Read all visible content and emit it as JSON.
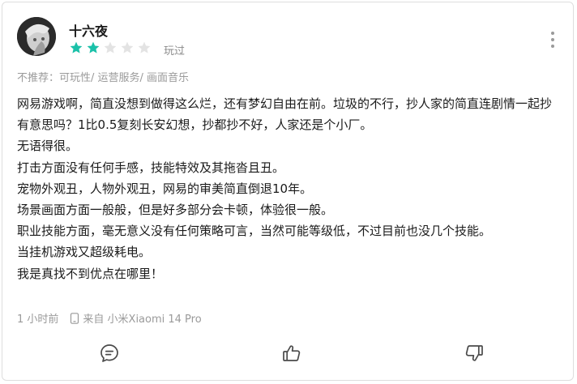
{
  "review": {
    "username": "十六夜",
    "rating": 2,
    "rating_max": 5,
    "played_label": "玩过",
    "tags": "不推荐：可玩性/ 运营服务/ 画面音乐",
    "body_lines": [
      "网易游戏啊，简直没想到做得这么烂，还有梦幻自由在前。垃圾的不行，抄人家的简直连剧情一起抄有意思吗？1比0.5复刻长安幻想，抄都抄不好，人家还是个小厂。",
      "无语得很。",
      "打击方面没有任何手感，技能特效及其拖沓且丑。",
      "宠物外观丑，人物外观丑，网易的审美简直倒退10年。",
      "场景画面方面一般般，但是好多部分会卡顿，体验很一般。",
      "职业技能方面，毫无意义没有任何策略可言，当然可能等级低，不过目前也没几个技能。",
      "当挂机游戏又超级耗电。",
      "我是真找不到优点在哪里！"
    ],
    "time": "1 小时前",
    "device": "来自 小米Xiaomi 14 Pro"
  },
  "colors": {
    "star_filled": "#1bc1a9",
    "star_empty": "#e3e3e3",
    "muted_text": "#9a9a9a"
  },
  "icons": {
    "more": "more-vertical-icon",
    "device": "phone-icon",
    "comment": "comment-icon",
    "like": "thumbs-up-icon",
    "dislike": "thumbs-down-icon"
  }
}
